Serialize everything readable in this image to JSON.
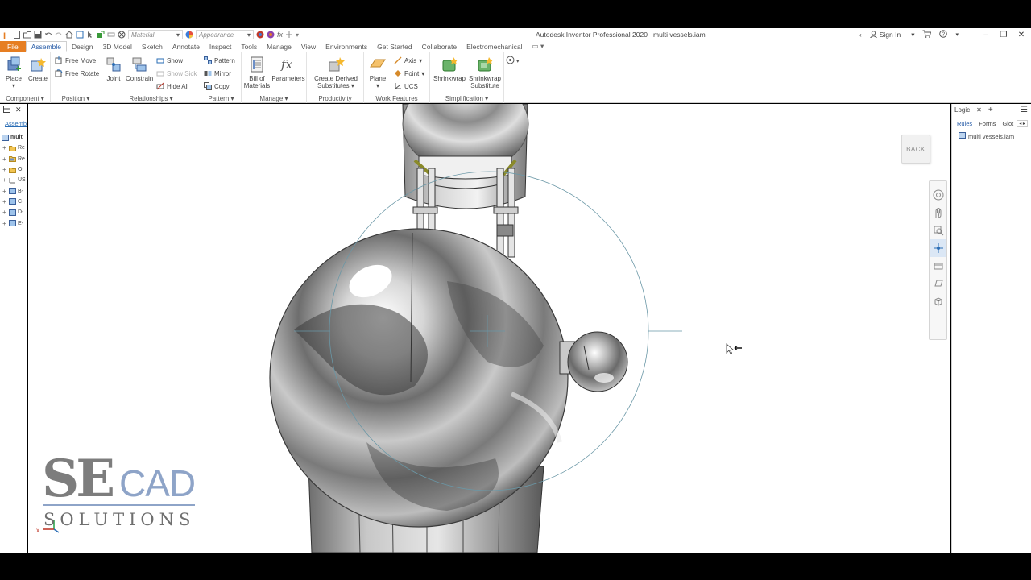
{
  "app": {
    "window_title": "Autodesk Inventor Professional 2020",
    "document_title": "multi vessels.iam",
    "sign_in": "Sign In"
  },
  "qat": {
    "material_value": "Material",
    "appearance_value": "Appearance",
    "fx": "fx"
  },
  "tabs": [
    "File",
    "Assemble",
    "Design",
    "3D Model",
    "Sketch",
    "Annotate",
    "Inspect",
    "Tools",
    "Manage",
    "View",
    "Environments",
    "Get Started",
    "Collaborate",
    "Electromechanical"
  ],
  "ribbon": {
    "component": {
      "title": "Component",
      "place": "Place",
      "create": "Create"
    },
    "position": {
      "title": "Position",
      "free_move": "Free Move",
      "free_rotate": "Free Rotate"
    },
    "relationships": {
      "title": "Relationships",
      "joint": "Joint",
      "constrain": "Constrain",
      "show": "Show",
      "show_sick": "Show Sick",
      "hide_all": "Hide All"
    },
    "pattern": {
      "title": "Pattern",
      "pattern": "Pattern",
      "mirror": "Mirror",
      "copy": "Copy"
    },
    "manage": {
      "title": "Manage",
      "bom_line1": "Bill of",
      "bom_line2": "Materials",
      "parameters": "Parameters"
    },
    "productivity": {
      "title": "Productivity",
      "cds_line1": "Create Derived",
      "cds_line2": "Substitutes"
    },
    "work_features": {
      "title": "Work Features",
      "plane": "Plane",
      "axis": "Axis",
      "point": "Point",
      "ucs": "UCS"
    },
    "simplification": {
      "title": "Simplification",
      "shrinkwrap": "Shrinkwrap",
      "shrinkwrap_sub_line1": "Shrinkwrap",
      "shrinkwrap_sub_line2": "Substitute"
    }
  },
  "browser": {
    "tab": "Assembl",
    "root": "mult",
    "nodes": [
      "Re",
      "Re",
      "Or",
      "US",
      "B-",
      "C-",
      "D-",
      "E-"
    ]
  },
  "viewport": {
    "back_button": "BACK"
  },
  "ilogic": {
    "title": "Logic",
    "tabs": [
      "Rules",
      "Forms",
      "Glot"
    ],
    "file": "multi vessels.iam"
  },
  "watermark": {
    "line1_a": "SE",
    "line1_b": "CAD",
    "line2": "SOLUTIONS"
  },
  "colors": {
    "file_tab": "#e67e22",
    "accent": "#2a5ea8",
    "logo_gray": "#7d7d7d",
    "logo_blue": "#8ea4c8"
  }
}
